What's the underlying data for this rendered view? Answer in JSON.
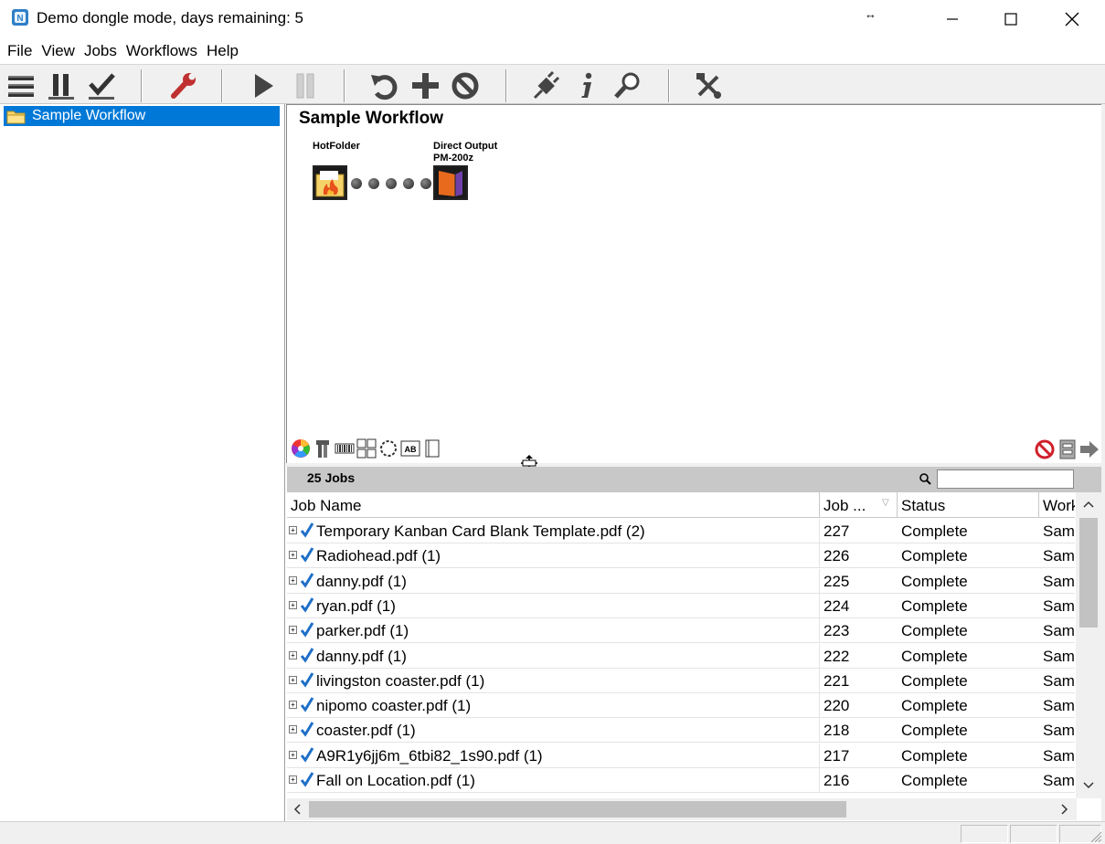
{
  "window": {
    "title": "Demo dongle mode, days remaining: 5"
  },
  "menu": [
    "File",
    "View",
    "Jobs",
    "Workflows",
    "Help"
  ],
  "toolbar": {
    "icons": [
      "menu-icon",
      "pause-icon",
      "checkmark-icon",
      "wrench-icon",
      "play-icon",
      "pause-disabled-icon",
      "refresh-icon",
      "plus-icon",
      "cancel-icon",
      "plug-icon",
      "info-icon",
      "magnifier-icon",
      "tools-icon"
    ]
  },
  "tree": {
    "items": [
      {
        "label": "Sample Workflow",
        "selected": true
      }
    ]
  },
  "workflow": {
    "title": "Sample Workflow",
    "nodes": [
      {
        "label": "HotFolder",
        "sublabel": ""
      },
      {
        "label": "Direct Output",
        "sublabel": "PM-200z"
      }
    ]
  },
  "jobs": {
    "count_label": "25 Jobs",
    "search_value": "",
    "columns": [
      "Job Name",
      "Job ...",
      "Status",
      "Work"
    ],
    "rows": [
      {
        "name": "Temporary Kanban Card Blank Template.pdf (2)",
        "job": "227",
        "status": "Complete",
        "workflow": "Sample Workflow"
      },
      {
        "name": "Radiohead.pdf (1)",
        "job": "226",
        "status": "Complete",
        "workflow": "Sample Workflow"
      },
      {
        "name": "danny.pdf (1)",
        "job": "225",
        "status": "Complete",
        "workflow": "Sample Workflow"
      },
      {
        "name": "ryan.pdf (1)",
        "job": "224",
        "status": "Complete",
        "workflow": "Sample Workflow"
      },
      {
        "name": "parker.pdf (1)",
        "job": "223",
        "status": "Complete",
        "workflow": "Sample Workflow"
      },
      {
        "name": "danny.pdf (1)",
        "job": "222",
        "status": "Complete",
        "workflow": "Sample Workflow"
      },
      {
        "name": "livingston coaster.pdf (1)",
        "job": "221",
        "status": "Complete",
        "workflow": "Sample Workflow"
      },
      {
        "name": "nipomo coaster.pdf (1)",
        "job": "220",
        "status": "Complete",
        "workflow": "Sample Workflow"
      },
      {
        "name": "coaster.pdf (1)",
        "job": "218",
        "status": "Complete",
        "workflow": "Sample Workflow"
      },
      {
        "name": "A9R1y6jj6m_6tbi82_1s90.pdf (1)",
        "job": "217",
        "status": "Complete",
        "workflow": "Sample Workflow"
      },
      {
        "name": "Fall on Location.pdf (1)",
        "job": "216",
        "status": "Complete",
        "workflow": "Sample Workflow"
      }
    ]
  },
  "colors": {
    "selection": "#0078d7",
    "jobs_header": "#c8c8c8",
    "check": "#1e6fc8"
  }
}
